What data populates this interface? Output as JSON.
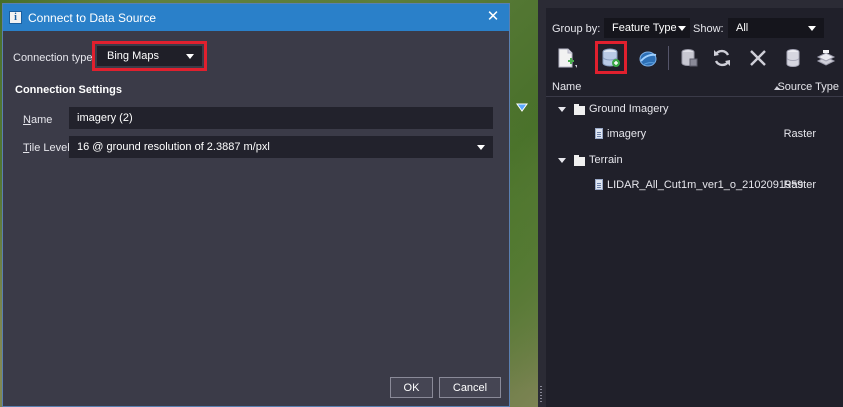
{
  "dialog": {
    "title": "Connect to Data Source",
    "close_glyph": "✕",
    "connection_type_label": "Connection type:",
    "connection_type_value": "Bing Maps",
    "section_title": "Connection Settings",
    "name_label_accel": "N",
    "name_label_rest": "ame",
    "name_value": "imagery (2)",
    "tile_level_label_accel": "T",
    "tile_level_label_rest": "ile Level",
    "tile_level_value": "16 @ ground resolution of 2.3887 m/pxl",
    "ok_label": "OK",
    "cancel_label": "Cancel"
  },
  "panel": {
    "group_by_label": "Group by:",
    "group_by_value": "Feature Type",
    "show_label": "Show:",
    "show_value": "All",
    "toolbar_icons": [
      "new-layer-icon",
      "add-data-source-icon",
      "web-service-icon",
      "database-icon",
      "refresh-icon",
      "remove-icon",
      "store-icon",
      "export-icon"
    ],
    "list_header": {
      "name": "Name",
      "source_type": "Source Type"
    },
    "tree": [
      {
        "label": "Ground Imagery",
        "children": [
          {
            "label": "imagery",
            "type": "Raster"
          }
        ]
      },
      {
        "label": "Terrain",
        "children": [
          {
            "label": "LIDAR_All_Cut1m_ver1_o_2102091959",
            "type": "Raster"
          }
        ]
      }
    ]
  },
  "colors": {
    "title_bar": "#2a80c9",
    "highlight": "#e0202e",
    "dialog_bg": "#3b3b48",
    "panel_bg": "#20202a"
  }
}
